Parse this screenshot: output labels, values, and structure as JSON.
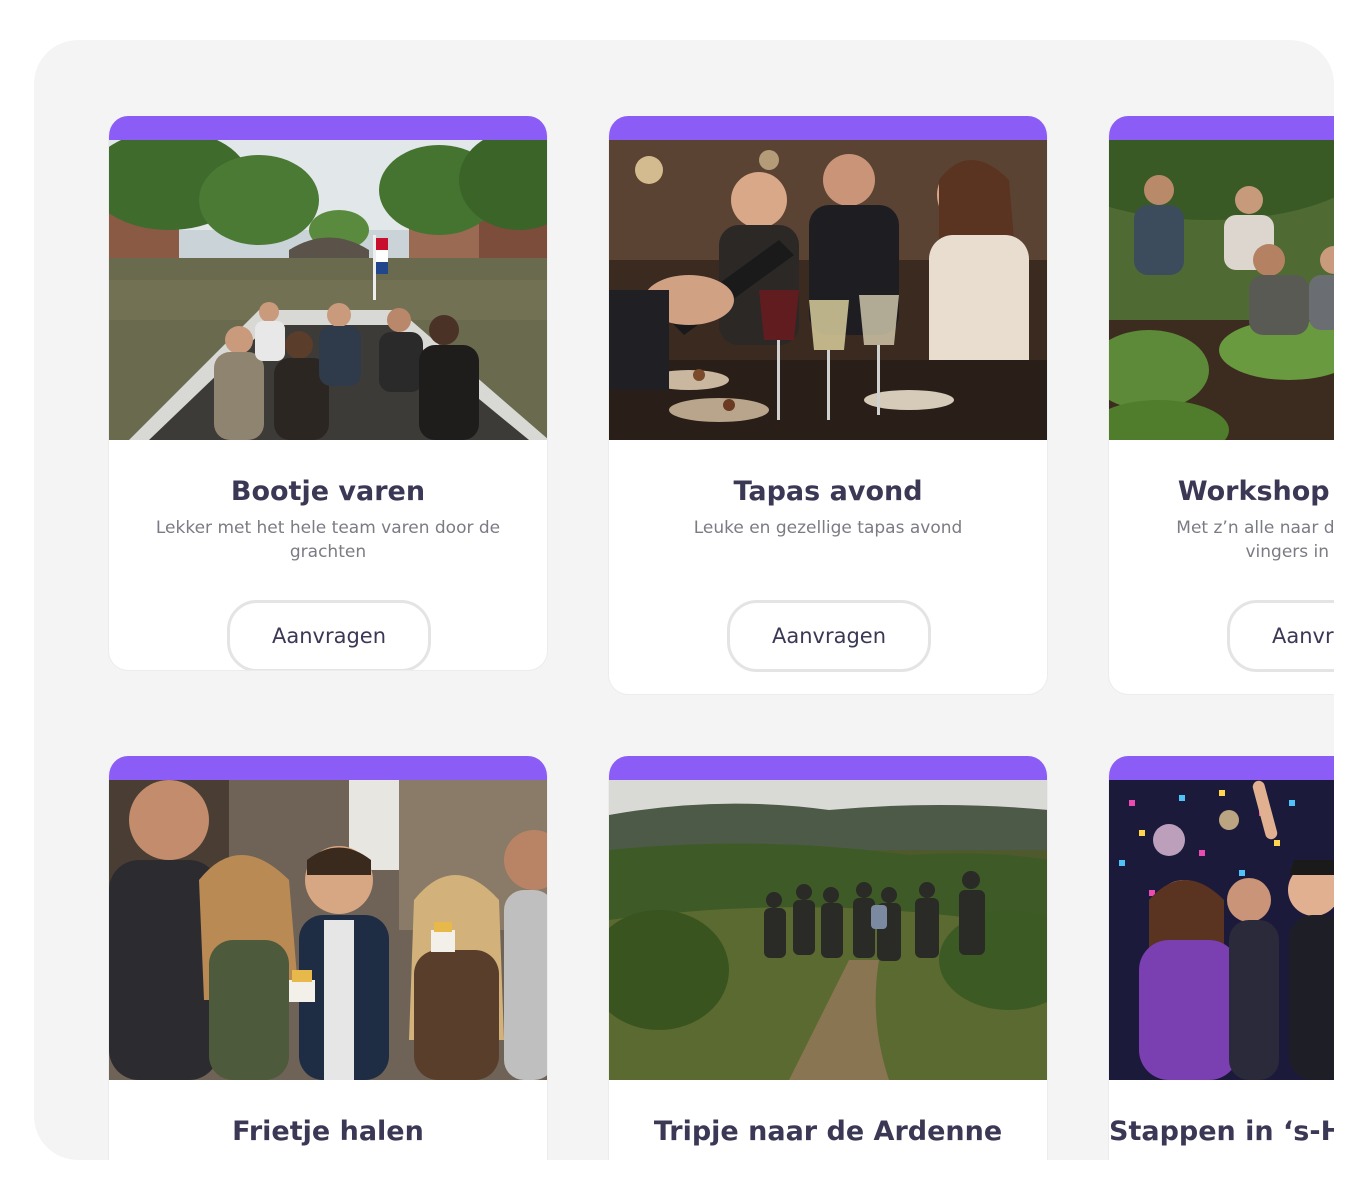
{
  "accent_color": "#8b5cf6",
  "cards": [
    {
      "title": "Bootje varen",
      "description": "Lekker met het hele team varen door de grachten",
      "button_label": "Aanvragen",
      "image": "canal-boat-photo"
    },
    {
      "title": "Tapas avond",
      "description": "Leuke en gezellige tapas avond",
      "button_label": "Aanvragen",
      "image": "tapas-dinner-photo"
    },
    {
      "title": "Workshop groenten",
      "description": "Met z’n alle naar de boerderij en de vingers in de grond",
      "button_label": "Aanvragen",
      "image": "gardening-workshop-photo"
    },
    {
      "title": "Frietje halen",
      "description": "",
      "button_label": "",
      "image": "street-fries-photo"
    },
    {
      "title": "Tripje naar de Ardenne",
      "description": "",
      "button_label": "",
      "image": "hiking-ardennes-photo"
    },
    {
      "title": "Stappen in ‘s-Hertogenbosch",
      "description": "",
      "button_label": "",
      "image": "party-confetti-photo"
    }
  ]
}
